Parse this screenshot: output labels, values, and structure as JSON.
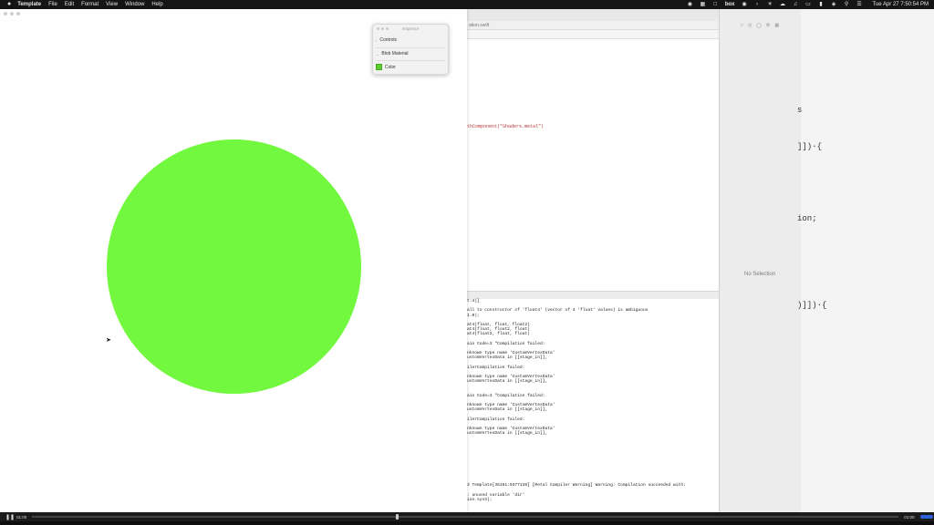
{
  "menubar": {
    "app_name": "Template",
    "menus": [
      "File",
      "Edit",
      "Format",
      "View",
      "Window",
      "Help"
    ],
    "status_icons": [
      "circle-dot-icon",
      "grid-icon",
      "box-icon",
      "record-icon",
      "chevron-icon",
      "sun-icon",
      "cloud-icon",
      "speaker-icon",
      "display-icon",
      "battery-icon",
      "wifi-icon",
      "search-icon",
      "control-center-icon"
    ],
    "box_label": "box",
    "clock": "Tue Apr 27  7:50:54 PM"
  },
  "editor": {
    "jumpbar_fragment": "ation.swift",
    "code_fragment": "thComponent(\"Shaders.metal\")",
    "console_lines": [
      "t:4)]",
      "",
      "all to constructor of 'float4' (vector of 4 'float' values) is ambiguous",
      "1.0);",
      "",
      "at4(float, float, float2)",
      "at4(float, float2, float)",
      "at4(float2, float, float)",
      "",
      "ain Code=3 \"Compilation failed:",
      "",
      "nknown type name 'CustomVertexData'",
      "ustomVertexData in [[stage_in]],",
      "",
      "ilerCompilation failed:",
      "",
      "nknown type name 'CustomVertexData'",
      "ustomVertexData in [[stage_in]],",
      "",
      "",
      "ain Code=3 \"Compilation failed:",
      "",
      "nknown type name 'CustomVertexData'",
      "ustomVertexData in [[stage_in]],",
      "",
      "ilerCompilation failed:",
      "",
      "nknown type name 'CustomVertexData'",
      "ustomVertexData in [[stage_in]],",
      "",
      "",
      "",
      "",
      "",
      "",
      "",
      "",
      "",
      "",
      "3 Template[35161:9377139] [Metal Compiler Warning] Warning: Compilation succeeded with:",
      "",
      ": unused variable 'dir'",
      "ion.sys3);"
    ]
  },
  "inspector_panel": {
    "no_selection": "No Selection"
  },
  "far_right_code": {
    "line1": "s",
    "line2": "]])·{",
    "line3": "ion;",
    "line4": ")]])·{"
  },
  "render_window": {
    "circle_color": "#72f83f"
  },
  "overlay": {
    "title": "Inspector",
    "sections": [
      {
        "label": "Controls"
      },
      {
        "label": "Blob Material"
      }
    ],
    "color_row": {
      "label": "Color",
      "swatch": "#5ccc2e"
    }
  },
  "playbar": {
    "time_elapsed": "01:00",
    "time_remaining": "01:00",
    "progress": 0.42
  }
}
